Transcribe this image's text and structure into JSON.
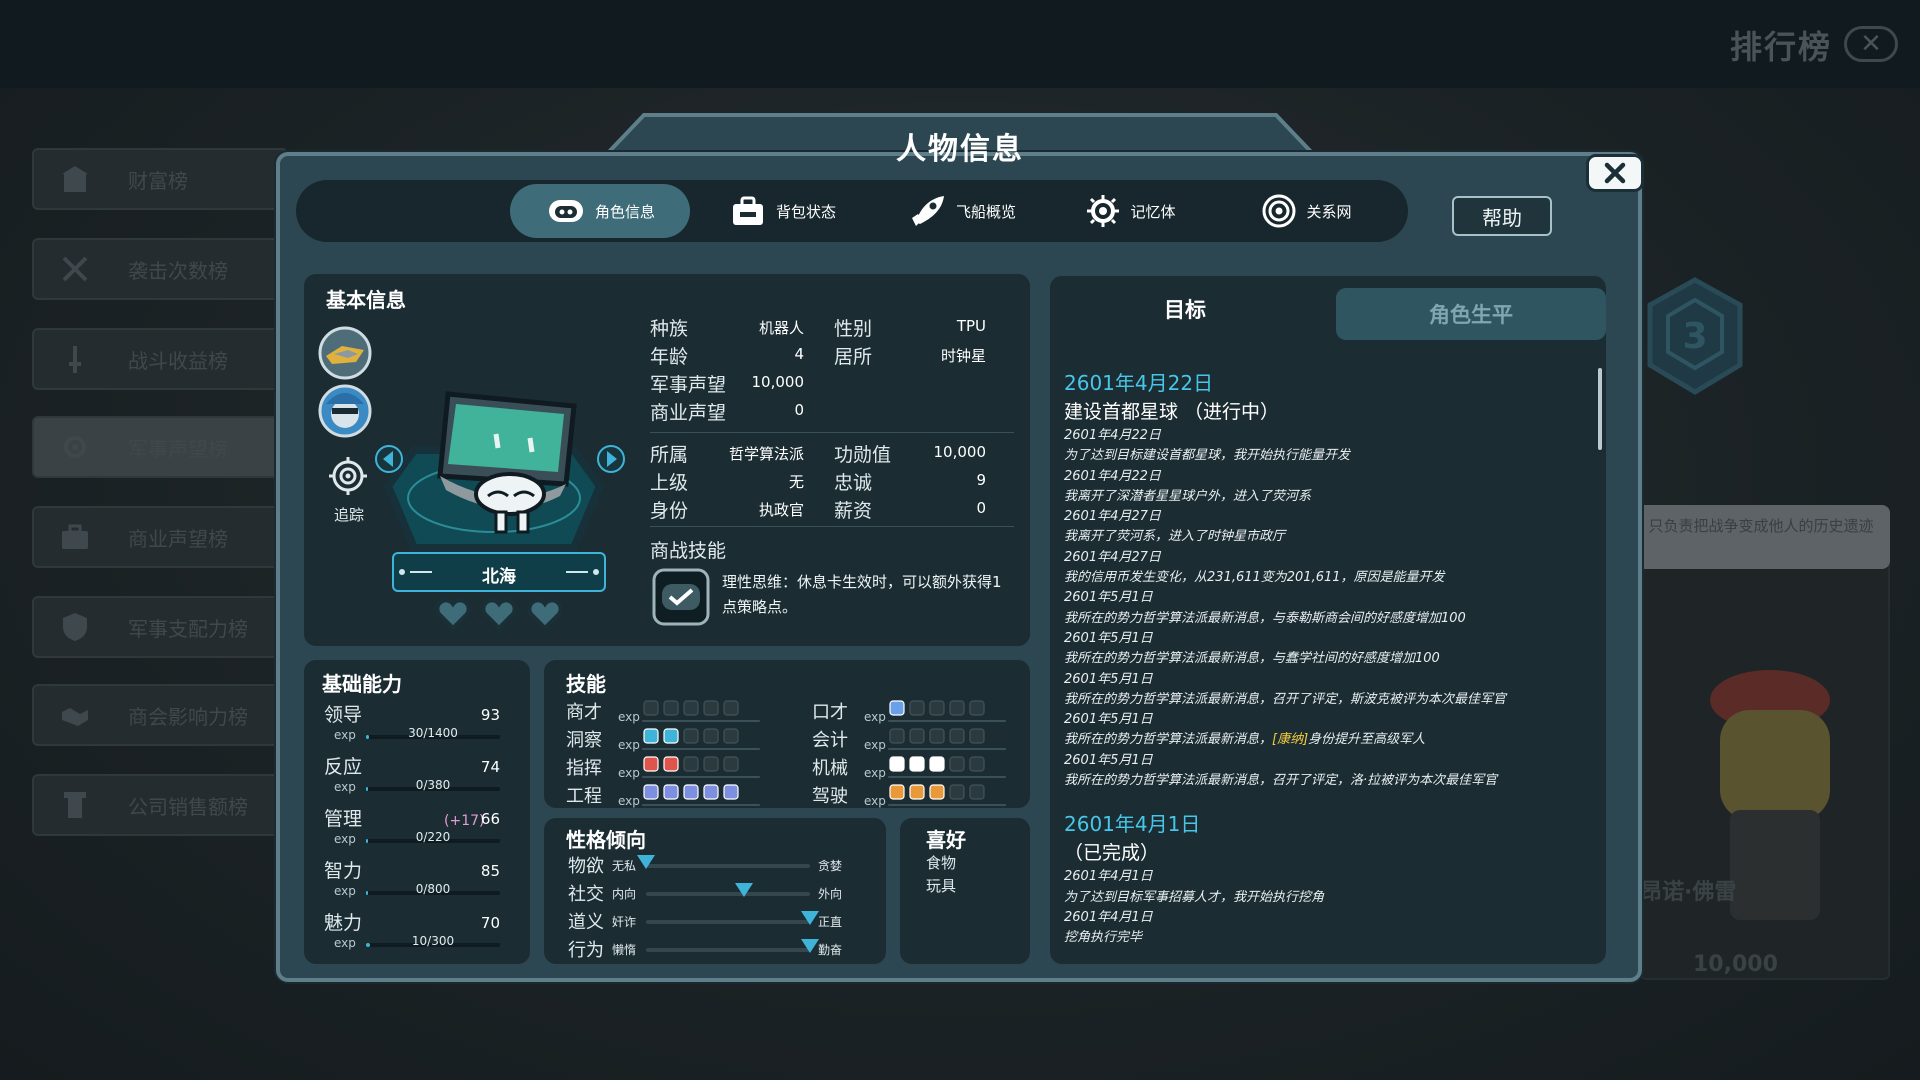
{
  "background": {
    "leaderboard_title": "排行榜",
    "leaderboard_close": "✕",
    "ranks": [
      {
        "label": "财富榜",
        "icon": "building-icon"
      },
      {
        "label": "袭击次数榜",
        "icon": "crossed-swords-icon"
      },
      {
        "label": "战斗收益榜",
        "icon": "sword-icon"
      },
      {
        "label": "军事声望榜",
        "icon": "gear-icon"
      },
      {
        "label": "商业声望榜",
        "icon": "briefcase-icon"
      },
      {
        "label": "军事支配力榜",
        "icon": "shield-icon"
      },
      {
        "label": "商会影响力榜",
        "icon": "handshake-icon"
      },
      {
        "label": "公司销售额榜",
        "icon": "tower-icon"
      }
    ],
    "rank_badge": "3",
    "bubble_text": "只负责把战争变成他人的历史遗迹",
    "portrait_name": "昂诺·佛雷",
    "portrait_value": "10,000"
  },
  "modal": {
    "title": "人物信息",
    "close": "✕",
    "help": "帮助",
    "tabs": [
      {
        "label": "角色信息",
        "icon": "robot-face-icon",
        "active": true
      },
      {
        "label": "背包状态",
        "icon": "backpack-icon",
        "active": false
      },
      {
        "label": "飞船概览",
        "icon": "rocket-icon",
        "active": false
      },
      {
        "label": "记忆体",
        "icon": "chip-icon",
        "active": false
      },
      {
        "label": "关系网",
        "icon": "network-icon",
        "active": false
      }
    ]
  },
  "basic": {
    "title": "基本信息",
    "track_label": "追踪",
    "name": "北海",
    "hearts": 3,
    "fields_left": [
      {
        "label": "种族",
        "value": "机器人"
      },
      {
        "label": "年龄",
        "value": "4"
      },
      {
        "label": "军事声望",
        "value": "10,000"
      },
      {
        "label": "商业声望",
        "value": "0"
      }
    ],
    "fields_right": [
      {
        "label": "性别",
        "value": "TPU"
      },
      {
        "label": "居所",
        "value": "时钟星"
      }
    ],
    "fields2_left": [
      {
        "label": "所属",
        "value": "哲学算法派"
      },
      {
        "label": "上级",
        "value": "无"
      },
      {
        "label": "身份",
        "value": "执政官"
      }
    ],
    "fields2_right": [
      {
        "label": "功勋值",
        "value": "10,000"
      },
      {
        "label": "忠诚",
        "value": "9"
      },
      {
        "label": "薪资",
        "value": "0"
      }
    ],
    "skill_title": "商战技能",
    "skill_desc": "理性思维：休息卡生效时，可以额外获得1点策略点。"
  },
  "abilities": {
    "title": "基础能力",
    "exp_label": "exp",
    "items": [
      {
        "label": "领导",
        "value": "93",
        "bonus": "",
        "exp": "30/1400",
        "fill": 0.02
      },
      {
        "label": "反应",
        "value": "74",
        "bonus": "",
        "exp": "0/380",
        "fill": 0.0
      },
      {
        "label": "管理",
        "value": "66",
        "bonus": "(+17)",
        "exp": "0/220",
        "fill": 0.0
      },
      {
        "label": "智力",
        "value": "85",
        "bonus": "",
        "exp": "0/800",
        "fill": 0.0
      },
      {
        "label": "魅力",
        "value": "70",
        "bonus": "",
        "exp": "10/300",
        "fill": 0.03
      }
    ]
  },
  "skills": {
    "title": "技能",
    "exp_label": "exp",
    "items": [
      {
        "label": "商才",
        "lit": 0,
        "color": "#8a9aa0"
      },
      {
        "label": "洞察",
        "lit": 2,
        "color": "#3fb4d8"
      },
      {
        "label": "指挥",
        "lit": 2,
        "color": "#e0554b"
      },
      {
        "label": "工程",
        "lit": 5,
        "color": "#7d8fe0"
      },
      {
        "label": "口才",
        "lit": 1,
        "color": "#6aa0e8"
      },
      {
        "label": "会计",
        "lit": 0,
        "color": "#8a9aa0"
      },
      {
        "label": "机械",
        "lit": 3,
        "color": "#ffffff"
      },
      {
        "label": "驾驶",
        "lit": 3,
        "color": "#e89a3a"
      }
    ]
  },
  "personality": {
    "title": "性格倾向",
    "items": [
      {
        "label": "物欲",
        "left": "无私",
        "right": "贪婪",
        "pos": 0.0
      },
      {
        "label": "社交",
        "left": "内向",
        "right": "外向",
        "pos": 0.6
      },
      {
        "label": "道义",
        "left": "奸诈",
        "right": "正直",
        "pos": 1.0
      },
      {
        "label": "行为",
        "left": "懒惰",
        "right": "勤奋",
        "pos": 1.0
      }
    ]
  },
  "hobby": {
    "title": "喜好",
    "items": [
      "食物",
      "玩具"
    ]
  },
  "goals": {
    "tab_active": "目标",
    "tab_inactive": "角色生平",
    "groups": [
      {
        "date": "2601年4月22日",
        "goal": "建设首都星球 （进行中）",
        "entries": [
          "2601年4月22日",
          "为了达到目标建设首都星球，我开始执行能量开发",
          "2601年4月22日",
          "我离开了深潜者星星球户外，进入了荧河系",
          "2601年4月27日",
          "我离开了荧河系，进入了时钟星市政厅",
          "2601年4月27日",
          "我的信用币发生变化，从231,611变为201,611，原因是能量开发",
          "2601年5月1日",
          "我所在的势力哲学算法派最新消息，与泰勒斯商会间的好感度增加100",
          "2601年5月1日",
          "我所在的势力哲学算法派最新消息，与蠢学社间的好感度增加100",
          "2601年5月1日",
          "我所在的势力哲学算法派最新消息，召开了评定，斯波克被评为本次最佳军官",
          "2601年5月1日",
          "我所在的势力哲学算法派最新消息，[康纳]身份提升至高级军人",
          "2601年5月1日",
          "我所在的势力哲学算法派最新消息，召开了评定，洛·拉被评为本次最佳军官"
        ]
      },
      {
        "date": "2601年4月1日",
        "goal": "（已完成）",
        "entries": [
          "2601年4月1日",
          "为了达到目标军事招募人才，我开始执行挖角",
          "2601年4月1日",
          "挖角执行完毕"
        ]
      }
    ]
  },
  "colors": {
    "accent": "#47c6ea",
    "panel": "#1b2d33",
    "modal": "#2c4752",
    "highlight": "#f3cc3e"
  }
}
